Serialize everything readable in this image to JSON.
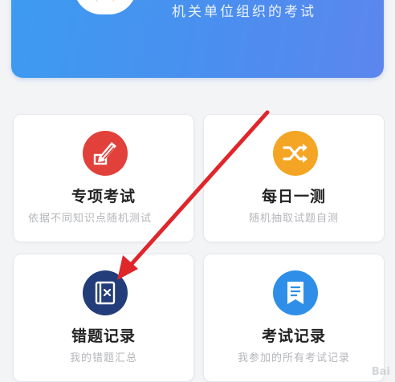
{
  "banner": {
    "subtitle": "机关单位组织的考试"
  },
  "cards": [
    {
      "title": "专项考试",
      "desc": "依据不同知识点随机测试",
      "icon": "pen-edit-icon",
      "color": "#e2403a"
    },
    {
      "title": "每日一测",
      "desc": "随机抽取试题自测",
      "icon": "shuffle-icon",
      "color": "#f5a524"
    },
    {
      "title": "错题记录",
      "desc": "我的错题汇总",
      "icon": "wrong-book-icon",
      "color": "#233c7a"
    },
    {
      "title": "考试记录",
      "desc": "我参加的所有考试记录",
      "icon": "document-icon",
      "color": "#2f8fe8"
    }
  ],
  "annotation": {
    "color": "#e0252b",
    "target": "错题记录"
  },
  "watermark": "Bai"
}
